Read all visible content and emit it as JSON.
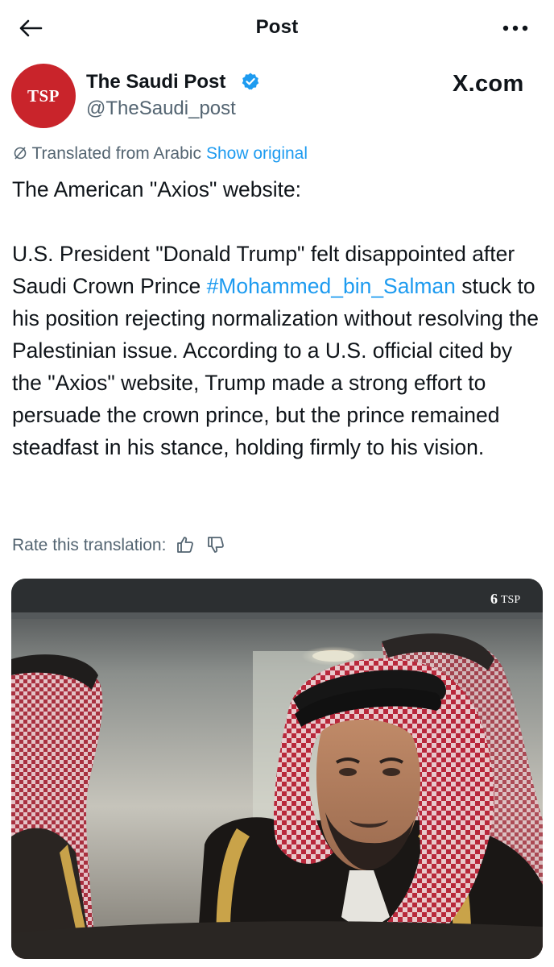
{
  "header": {
    "title": "Post"
  },
  "author": {
    "avatar_text": "TSP",
    "display_name": "The Saudi Post",
    "handle": "@TheSaudi_post",
    "verified": true
  },
  "watermark": "X.com",
  "translation": {
    "label": "Translated from Arabic",
    "show_original": "Show original",
    "rate_label": "Rate this translation:"
  },
  "post": {
    "line1": "The American \"Axios\" website:",
    "para2_before": "U.S. President \"Donald Trump\" felt disappointed after Saudi Crown Prince ",
    "hashtag": "#Mohammed_bin_Salman",
    "para2_after": " stuck to his position rejecting normalization without resolving the Palestinian issue. According to a U.S. official cited by the \"Axios\" website, Trump made a strong effort to persuade the crown prince, but the prince remained steadfast in his stance, holding firmly to his vision."
  },
  "media": {
    "watermark": "TSP"
  },
  "colors": {
    "link": "#1d9bf0",
    "secondary_text": "#536471",
    "avatar_bg": "#c9242b"
  }
}
